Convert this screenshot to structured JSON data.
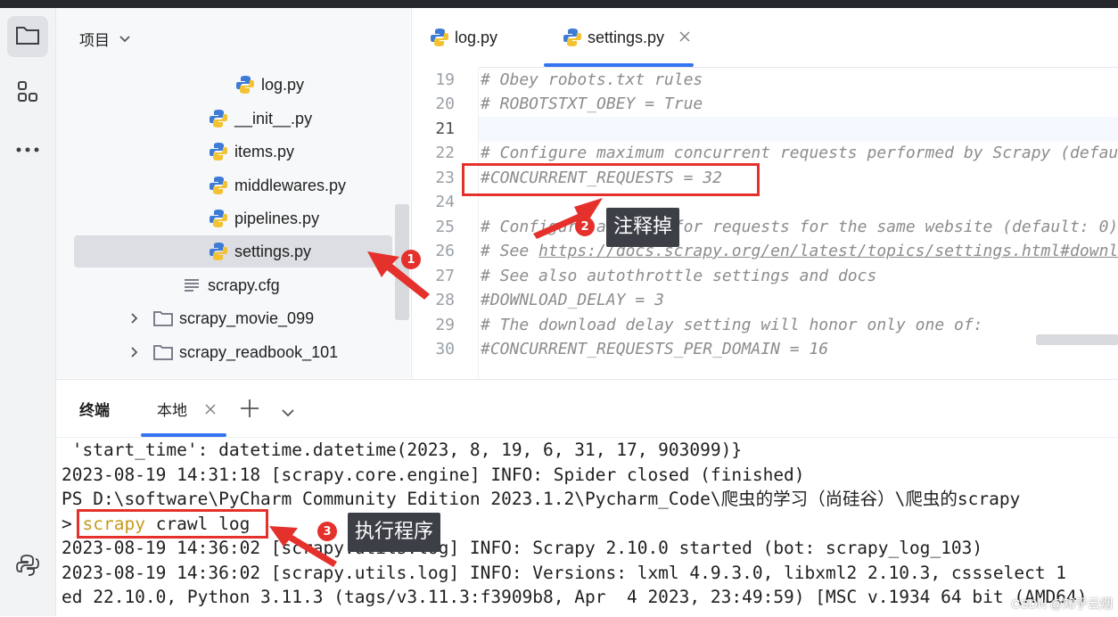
{
  "project": {
    "header": "项目",
    "tree": [
      {
        "label": "log.py",
        "type": "python"
      },
      {
        "label": "__init__.py",
        "type": "python"
      },
      {
        "label": "items.py",
        "type": "python"
      },
      {
        "label": "middlewares.py",
        "type": "python"
      },
      {
        "label": "pipelines.py",
        "type": "python"
      },
      {
        "label": "settings.py",
        "type": "python",
        "selected": true
      },
      {
        "label": "scrapy.cfg",
        "type": "config"
      },
      {
        "label": "scrapy_movie_099",
        "type": "folder"
      },
      {
        "label": "scrapy_readbook_101",
        "type": "folder"
      }
    ]
  },
  "editor": {
    "tabs": [
      {
        "label": "log.py"
      },
      {
        "label": "settings.py",
        "active": true
      }
    ],
    "lines": [
      {
        "num": "19",
        "text": "# Obey robots.txt rules"
      },
      {
        "num": "20",
        "text": "# ROBOTSTXT_OBEY = True"
      },
      {
        "num": "21",
        "text": ""
      },
      {
        "num": "22",
        "text": "# Configure maximum concurrent requests performed by Scrapy (defau"
      },
      {
        "num": "23",
        "text": "#CONCURRENT_REQUESTS = 32"
      },
      {
        "num": "24",
        "text": ""
      },
      {
        "num": "25",
        "text": "# Configure a delay for requests for the same website (default: 0)"
      },
      {
        "num": "26",
        "text_prefix": "# See ",
        "link": "https://docs.scrapy.org/en/latest/topics/settings.html#download-delay"
      },
      {
        "num": "27",
        "text": "# See also autothrottle settings and docs"
      },
      {
        "num": "28",
        "text": "#DOWNLOAD_DELAY = 3"
      },
      {
        "num": "29",
        "text": "# The download delay setting will honor only one of:"
      },
      {
        "num": "30",
        "text": "#CONCURRENT_REQUESTS_PER_DOMAIN = 16"
      }
    ]
  },
  "terminal": {
    "title": "终端",
    "tab": "本地",
    "lines": [
      " 'start_time': datetime.datetime(2023, 8, 19, 6, 31, 17, 903099)}",
      "2023-08-19 14:31:18 [scrapy.core.engine] INFO: Spider closed (finished)",
      "PS D:\\software\\PyCharm Community Edition 2023.1.2\\Pycharm_Code\\爬虫的学习（尚硅谷）\\爬虫的scrapy",
      "",
      "2023-08-19 14:36:02 [scrapy.utils.log] INFO: Scrapy 2.10.0 started (bot: scrapy_log_103)",
      "2023-08-19 14:36:02 [scrapy.utils.log] INFO: Versions: lxml 4.9.3.0, libxml2 2.10.3, cssselect 1",
      "ed 22.10.0, Python 3.11.3 (tags/v3.11.3:f3909b8, Apr  4 2023, 23:49:59) [MSC v.1934 64 bit (AMD64)"
    ],
    "prompt": ">",
    "cmd_word": "scrapy",
    "cmd_rest": " crawl log"
  },
  "annotations": {
    "marker1": "1",
    "marker2": "2",
    "marker3": "3",
    "callout2": "注释掉",
    "callout3": "执行程序",
    "color": "#e5312c"
  },
  "watermark": "CSDN @知乎云烟"
}
